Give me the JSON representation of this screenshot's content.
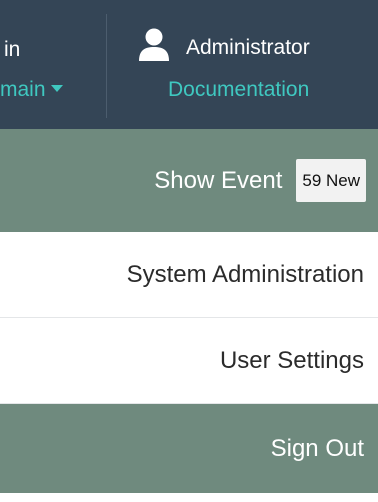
{
  "topbar": {
    "left_line1": "in",
    "left_line2": "main",
    "user_name": "Administrator",
    "documentation_link": "Documentation"
  },
  "menu": {
    "show_event_label": "Show Event",
    "event_badge": "59 New",
    "system_admin_label": "System Administration",
    "user_settings_label": "User Settings",
    "sign_out_label": "Sign Out"
  },
  "icons": {
    "user": "user-icon",
    "domain_dropdown": "caret-down-icon"
  },
  "colors": {
    "header_bg": "#344556",
    "accent_link": "#3fc8c0",
    "highlight_row": "#6f8a7e"
  }
}
